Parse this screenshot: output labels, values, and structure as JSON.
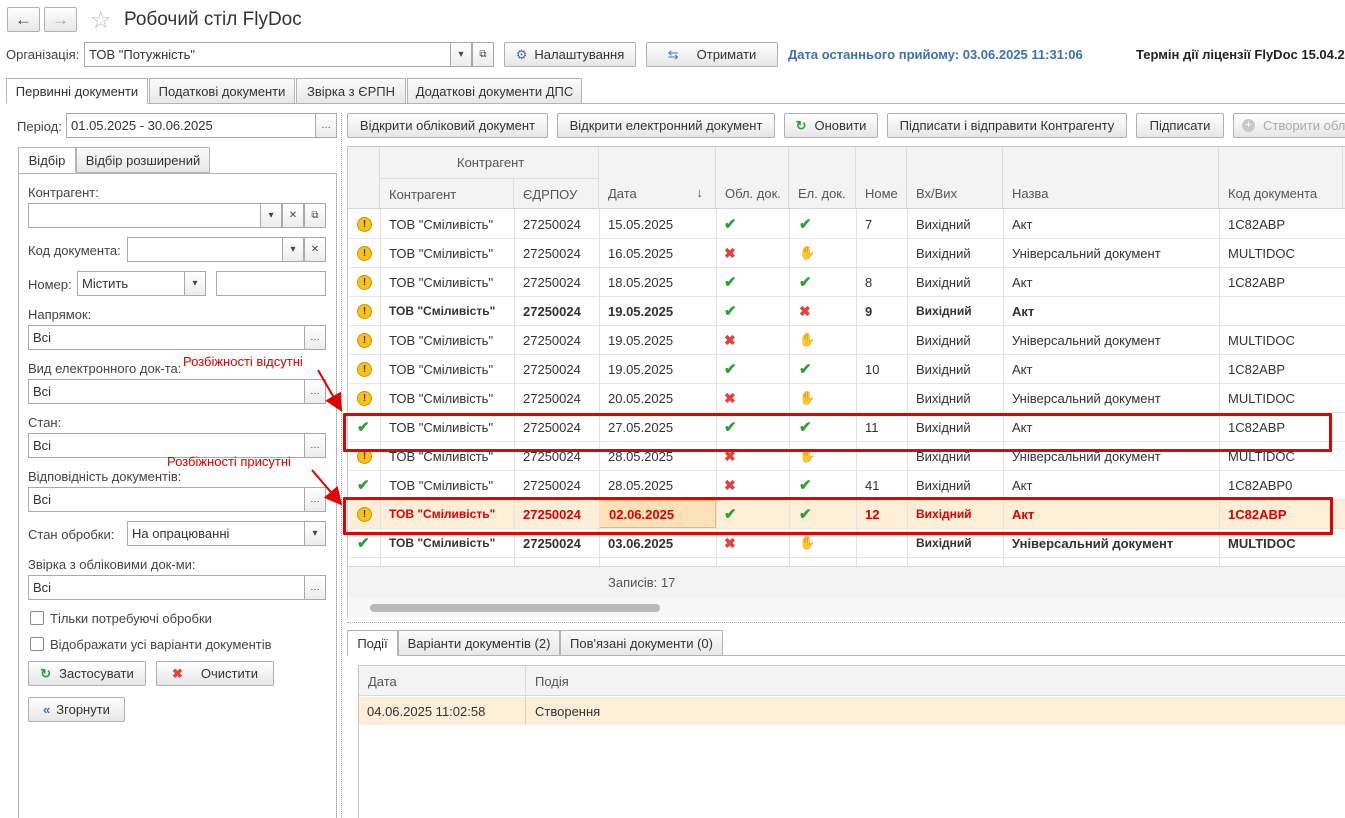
{
  "window": {
    "title": "Робочий стіл FlyDoc",
    "back_icon": "←",
    "forward_icon": "→",
    "star_icon": "☆"
  },
  "toolbar": {
    "org_label": "Організація:",
    "org_value": "ТОВ \"Потужність\"",
    "settings_label": "Налаштування",
    "receive_label": "Отримати",
    "last_receive": "Дата останнього прийому: 03.06.2025 11:31:06",
    "license": "Термін дії ліцензії FlyDoc 15.04.2"
  },
  "tabs": [
    "Первинні документи",
    "Податкові документи",
    "Звірка з ЄРПН",
    "Додаткові документи ДПС"
  ],
  "filter": {
    "period_label": "Період:",
    "period_value": "01.05.2025 - 30.06.2025",
    "subtabs": [
      "Відбір",
      "Відбір розширений"
    ],
    "contractor_label": "Контрагент:",
    "contractor_value": "",
    "doccode_label": "Код документа:",
    "doccode_value": "",
    "number_label": "Номер:",
    "number_mode": "Містить",
    "number_value": "",
    "direction_label": "Напрямок:",
    "direction_value": "Всі",
    "edoc_label": "Вид електронного док-та:",
    "edoc_value": "Всі",
    "state_label": "Стан:",
    "state_value": "Всі",
    "match_label": "Відповідність документів:",
    "match_value": "Всі",
    "proc_label": "Стан обробки:",
    "proc_value": "На опрацюванні",
    "reconcile_label": "Звірка з обліковими док-ми:",
    "reconcile_value": "Всі",
    "cb_need_label": "Тільки потребуючі обробки",
    "cb_all_label": "Відображати усі варіанти документів",
    "apply_label": "Застосувати",
    "clear_label": "Очистити",
    "collapse_label": "Згорнути"
  },
  "actions": {
    "open_acc": "Відкрити обліковий документ",
    "open_el": "Відкрити електронний документ",
    "refresh": "Оновити",
    "sign_send": "Підписати і відправити Контрагенту",
    "sign": "Підписати",
    "create": "Створити облі"
  },
  "grid": {
    "group_header": "Контрагент",
    "columns": [
      "Контрагент",
      "ЄДРПОУ",
      "Дата",
      "Обл. док.",
      "Ел. док.",
      "Номе",
      "Вх/Вих",
      "Назва",
      "Код документа"
    ],
    "sort_icon": "↓",
    "rows": [
      {
        "icon": "warn",
        "contractor": "ТОВ \"Сміливість\"",
        "edrpou": "27250024",
        "date": "15.05.2025",
        "acc": "ok",
        "el": "ok",
        "num": "7",
        "dir": "Вихідний",
        "name": "Акт",
        "code": "1С82АВР",
        "bold": false
      },
      {
        "icon": "warn",
        "contractor": "ТОВ \"Сміливість\"",
        "edrpou": "27250024",
        "date": "16.05.2025",
        "acc": "x",
        "el": "clip",
        "num": "",
        "dir": "Вихідний",
        "name": "Універсальний документ",
        "code": "MULTIDOC",
        "bold": false
      },
      {
        "icon": "warn",
        "contractor": "ТОВ \"Сміливість\"",
        "edrpou": "27250024",
        "date": "18.05.2025",
        "acc": "ok",
        "el": "ok",
        "num": "8",
        "dir": "Вихідний",
        "name": "Акт",
        "code": "1С82АВР",
        "bold": false
      },
      {
        "icon": "warn",
        "contractor": "ТОВ \"Сміливість\"",
        "edrpou": "27250024",
        "date": "19.05.2025",
        "acc": "ok",
        "el": "x",
        "num": "9",
        "dir": "Вихідний",
        "name": "Акт",
        "code": "",
        "bold": true
      },
      {
        "icon": "warn",
        "contractor": "ТОВ \"Сміливість\"",
        "edrpou": "27250024",
        "date": "19.05.2025",
        "acc": "x",
        "el": "clip",
        "num": "",
        "dir": "Вихідний",
        "name": "Універсальний документ",
        "code": "MULTIDOC",
        "bold": false
      },
      {
        "icon": "warn",
        "contractor": "ТОВ \"Сміливість\"",
        "edrpou": "27250024",
        "date": "19.05.2025",
        "acc": "ok",
        "el": "ok",
        "num": "10",
        "dir": "Вихідний",
        "name": "Акт",
        "code": "1С82АВР",
        "bold": false
      },
      {
        "icon": "warn",
        "contractor": "ТОВ \"Сміливість\"",
        "edrpou": "27250024",
        "date": "20.05.2025",
        "acc": "x",
        "el": "clip",
        "num": "",
        "dir": "Вихідний",
        "name": "Універсальний документ",
        "code": "MULTIDOC",
        "bold": false
      },
      {
        "icon": "ok",
        "contractor": "ТОВ \"Сміливість\"",
        "edrpou": "27250024",
        "date": "27.05.2025",
        "acc": "ok",
        "el": "ok",
        "num": "11",
        "dir": "Вихідний",
        "name": "Акт",
        "code": "1С82АВР",
        "bold": false
      },
      {
        "icon": "warn",
        "contractor": "ТОВ \"Сміливість\"",
        "edrpou": "27250024",
        "date": "28.05.2025",
        "acc": "x",
        "el": "clip",
        "num": "",
        "dir": "Вихідний",
        "name": "Універсальний документ",
        "code": "MULTIDOC",
        "bold": false
      },
      {
        "icon": "ok",
        "contractor": "ТОВ \"Сміливість\"",
        "edrpou": "27250024",
        "date": "28.05.2025",
        "acc": "x",
        "el": "ok",
        "num": "41",
        "dir": "Вихідний",
        "name": "Акт",
        "code": "1С82АВР0",
        "bold": false
      },
      {
        "icon": "warn",
        "contractor": "ТОВ \"Сміливість\"",
        "edrpou": "27250024",
        "date": "02.06.2025",
        "acc": "ok",
        "el": "ok",
        "num": "12",
        "dir": "Вихідний",
        "name": "Акт",
        "code": "1С82АВР",
        "bold": true,
        "selected": true
      },
      {
        "icon": "ok",
        "contractor": "ТОВ \"Сміливість\"",
        "edrpou": "27250024",
        "date": "03.06.2025",
        "acc": "x",
        "el": "clip",
        "num": "",
        "dir": "Вихідний",
        "name": "Універсальний документ",
        "code": "MULTIDOC",
        "bold": true
      }
    ],
    "footer": "Записів: 17"
  },
  "annotations": {
    "no_diff": "Розбіжності відсутні",
    "has_diff": "Розбіжності присутні"
  },
  "bottom": {
    "tabs": [
      "Події",
      "Варіанти документів (2)",
      "Пов'язані документи (0)"
    ],
    "columns": [
      "Дата",
      "Подія"
    ],
    "rows": [
      {
        "date": "04.06.2025 11:02:58",
        "event": "Створення"
      }
    ]
  },
  "colors": {
    "accent_blue": "#3f6fb7",
    "selected_row": "#fdeed8",
    "annotation_red": "#e00000"
  }
}
